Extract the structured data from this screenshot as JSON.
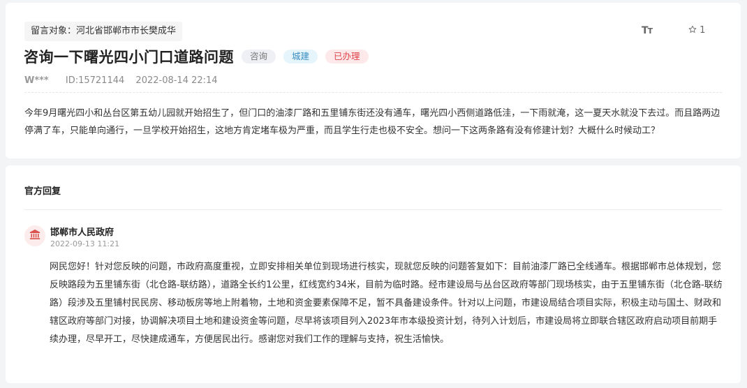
{
  "message": {
    "target_label": "留言对象：河北省邯郸市市长樊成华",
    "font_toggle_big": "T",
    "font_toggle_small": "T",
    "star_count": "1",
    "title": "咨询一下曙光四小门口道路问题",
    "badges": [
      "咨询",
      "城建",
      "已办理"
    ],
    "user": "W***",
    "id": "ID:15721144",
    "datetime": "2022-08-14 22:14",
    "body": "今年9月曙光四小和丛台区第五幼儿园就开始招生了，但门口的油漆厂路和五里铺东街还没有通车，曙光四小西侧道路低洼，一下雨就淹，这一夏天水就没下去过。而且路两边停满了车，只能单向通行，一旦学校开始招生，这地方肯定堵车极为严重，而且学生行走也极不安全。想问一下这两条路有没有修建计划？大概什么时候动工？"
  },
  "reply": {
    "heading": "官方回复",
    "org": "邯郸市人民政府",
    "time": "2022-09-13 11:21",
    "body": "网民您好！针对您反映的问题，市政府高度重视，立即安排相关单位到现场进行核实，现就您反映的问题答复如下：目前油漆厂路已全线通车。根据邯郸市总体规划，您反映路段为五里铺东街（北仓路-联纺路），道路全长约1公里，红线宽约34米，目前为临时路。经市建设局与丛台区政府等部门现场核实，由于五里铺东街（北仓路-联纺路）段涉及五里铺村民民房、移动板房等地上附着物，土地和资金要素保障不足，暂不具备建设条件。针对以上问题，市建设局结合项目实际，积极主动与国土、财政和辖区政府等部门对接，协调解决项目土地和建设资金等问题，尽早将该项目列入2023年市本级投资计划，待列入计划后，市建设局将立即联合辖区政府启动项目前期手续办理，尽早开工，尽快建成通车，方便居民出行。感谢您对我们工作的理解与支持，祝生活愉快。"
  },
  "colors": {
    "badge_consult": "#777777",
    "badge_urban": "#3a8fc2",
    "badge_done": "#e0434b",
    "avatar_icon": "#d9534f"
  },
  "icons": {
    "font_size": "font-size-icon",
    "star": "star-icon",
    "avatar": "government-building-icon"
  }
}
